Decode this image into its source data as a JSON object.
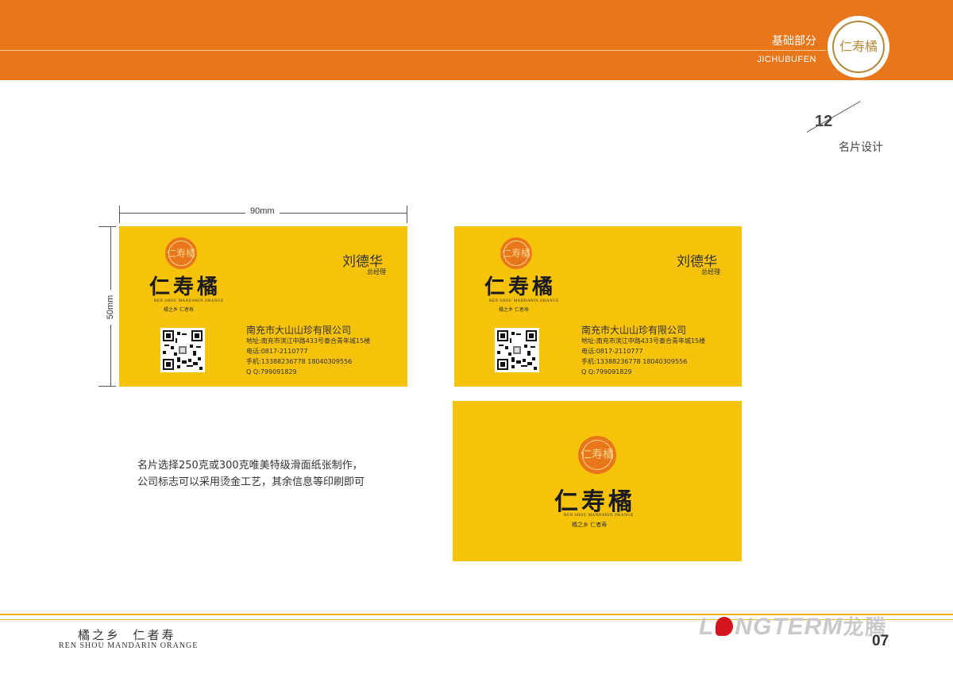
{
  "header": {
    "title": "基础部分",
    "subtitle": "JICHUBUFEN",
    "seal_text": "仁寿橘"
  },
  "section": {
    "number": "12",
    "label": "名片设计"
  },
  "dimensions": {
    "width": "90mm",
    "height": "50mm"
  },
  "card": {
    "seal_text": "仁寿橘",
    "brand": "仁寿橘",
    "brand_en": "REN SHOU MANDARIN ORANGE",
    "slogan": "橘之乡   仁者寿",
    "name": "刘德华",
    "role": "总经理",
    "company": "南充市大山山珍有限公司",
    "address": "地址:南充市滨江中路433号泰合青年城15楼",
    "phone": "电话:0817-2110777",
    "mobile": "手机:13388236778    18040309556",
    "qq": "Q  Q:799091829"
  },
  "description": {
    "line1": "名片选择250克或300克唯美特级滑面纸张制作，",
    "line2": "公司标志可以采用烫金工艺，其余信息等印刷即可"
  },
  "footer": {
    "slogan": "橘之乡  仁者寿",
    "slogan_en": "REN SHOU MANDARIN ORANGE",
    "logo_part1": "L",
    "logo_part2": "NGTERM",
    "logo_cn": "龙腾",
    "page_number": "07"
  },
  "colors": {
    "header_orange": "#e8761a",
    "card_yellow": "#f6c20a",
    "footer_line": "#f0b21b",
    "logo_red": "#d3161c"
  }
}
